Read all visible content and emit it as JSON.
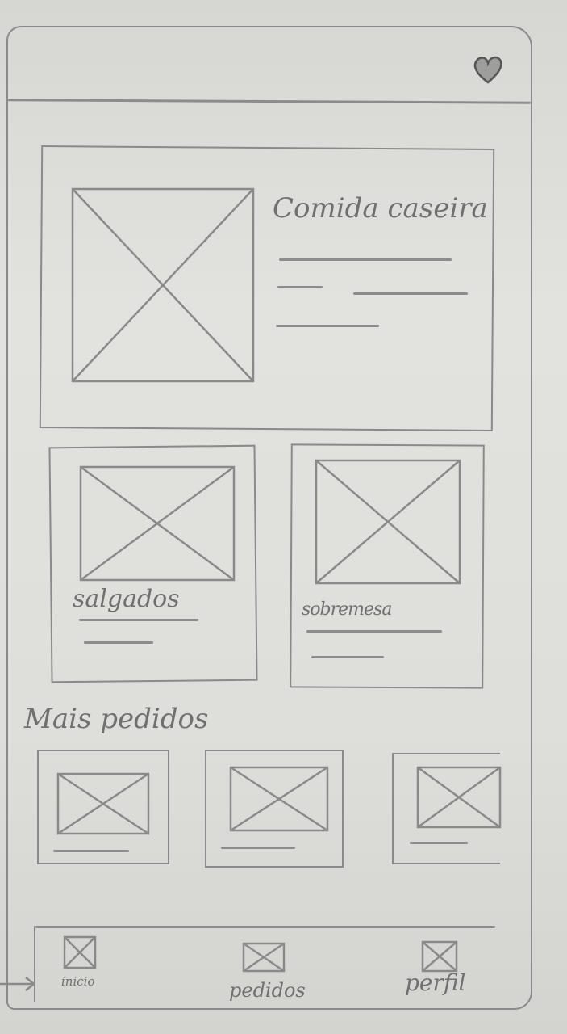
{
  "header": {
    "favorite_icon": "heart-icon"
  },
  "featured": {
    "title": "Comida caseira"
  },
  "categories": [
    {
      "label": "salgados"
    },
    {
      "label": "sobremesa"
    }
  ],
  "popular": {
    "title": "Mais pedidos",
    "items": [
      {
        "image": "image-placeholder"
      },
      {
        "image": "image-placeholder"
      },
      {
        "image": "image-placeholder"
      }
    ]
  },
  "bottom_nav": {
    "items": [
      {
        "label": "inicio",
        "icon": "image-placeholder-icon"
      },
      {
        "label": "pedidos",
        "icon": "image-placeholder-icon"
      },
      {
        "label": "perfil",
        "icon": "image-placeholder-icon"
      }
    ]
  }
}
